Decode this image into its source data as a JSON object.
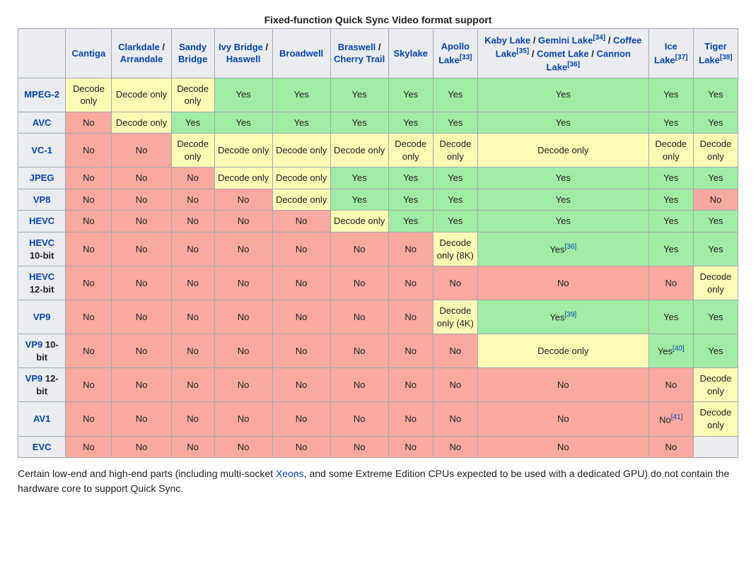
{
  "caption": "Fixed-function Quick Sync Video format support",
  "headers": [
    {
      "parts": [
        {
          "t": "Cantiga",
          "link": true
        }
      ]
    },
    {
      "parts": [
        {
          "t": "Clarkdale",
          "link": true
        },
        {
          "t": " / "
        },
        {
          "t": "Arrandale",
          "link": true
        }
      ]
    },
    {
      "parts": [
        {
          "t": "Sandy Bridge",
          "link": true
        }
      ]
    },
    {
      "parts": [
        {
          "t": "Ivy Bridge",
          "link": true
        },
        {
          "t": " / "
        },
        {
          "t": "Haswell",
          "link": true
        }
      ]
    },
    {
      "parts": [
        {
          "t": "Broadwell",
          "link": true
        }
      ]
    },
    {
      "parts": [
        {
          "t": "Braswell",
          "link": true
        },
        {
          "t": " / "
        },
        {
          "t": "Cherry Trail",
          "link": true
        }
      ]
    },
    {
      "parts": [
        {
          "t": "Skylake",
          "link": true
        }
      ]
    },
    {
      "parts": [
        {
          "t": "Apollo Lake",
          "link": true
        },
        {
          "sup": "[33]"
        }
      ]
    },
    {
      "parts": [
        {
          "t": "Kaby Lake",
          "link": true
        },
        {
          "t": " / "
        },
        {
          "t": "Gemini Lake",
          "link": true
        },
        {
          "sup": "[34]"
        },
        {
          "t": " / "
        },
        {
          "t": "Coffee Lake",
          "link": true
        },
        {
          "sup": "[35]"
        },
        {
          "t": " / "
        },
        {
          "t": "Comet Lake",
          "link": true
        },
        {
          "t": " / "
        },
        {
          "t": "Cannon Lake",
          "link": true
        },
        {
          "sup": "[36]"
        }
      ]
    },
    {
      "parts": [
        {
          "t": "Ice Lake",
          "link": true
        },
        {
          "sup": "[37]"
        }
      ]
    },
    {
      "parts": [
        {
          "t": "Tiger Lake",
          "link": true
        },
        {
          "sup": "[38]"
        }
      ]
    }
  ],
  "rows": [
    {
      "label": [
        {
          "t": "MPEG-2",
          "link": true
        }
      ],
      "cells": [
        {
          "v": "Decode only",
          "c": "decode"
        },
        {
          "v": "Decode only",
          "c": "decode"
        },
        {
          "v": "Decode only",
          "c": "decode"
        },
        {
          "v": "Yes",
          "c": "yes"
        },
        {
          "v": "Yes",
          "c": "yes"
        },
        {
          "v": "Yes",
          "c": "yes"
        },
        {
          "v": "Yes",
          "c": "yes"
        },
        {
          "v": "Yes",
          "c": "yes"
        },
        {
          "v": "Yes",
          "c": "yes"
        },
        {
          "v": "Yes",
          "c": "yes"
        },
        {
          "v": "Yes",
          "c": "yes"
        }
      ]
    },
    {
      "label": [
        {
          "t": "AVC",
          "link": true
        }
      ],
      "cells": [
        {
          "v": "No",
          "c": "no"
        },
        {
          "v": "Decode only",
          "c": "decode"
        },
        {
          "v": "Yes",
          "c": "yes"
        },
        {
          "v": "Yes",
          "c": "yes"
        },
        {
          "v": "Yes",
          "c": "yes"
        },
        {
          "v": "Yes",
          "c": "yes"
        },
        {
          "v": "Yes",
          "c": "yes"
        },
        {
          "v": "Yes",
          "c": "yes"
        },
        {
          "v": "Yes",
          "c": "yes"
        },
        {
          "v": "Yes",
          "c": "yes"
        },
        {
          "v": "Yes",
          "c": "yes"
        }
      ]
    },
    {
      "label": [
        {
          "t": "VC-1",
          "link": true
        }
      ],
      "cells": [
        {
          "v": "No",
          "c": "no"
        },
        {
          "v": "No",
          "c": "no"
        },
        {
          "v": "Decode only",
          "c": "decode"
        },
        {
          "v": "Decode only",
          "c": "decode"
        },
        {
          "v": "Decode only",
          "c": "decode"
        },
        {
          "v": "Decode only",
          "c": "decode"
        },
        {
          "v": "Decode only",
          "c": "decode"
        },
        {
          "v": "Decode only",
          "c": "decode"
        },
        {
          "v": "Decode only",
          "c": "decode"
        },
        {
          "v": "Decode only",
          "c": "decode"
        },
        {
          "v": "Decode only",
          "c": "decode"
        }
      ]
    },
    {
      "label": [
        {
          "t": "JPEG",
          "link": true
        }
      ],
      "cells": [
        {
          "v": "No",
          "c": "no"
        },
        {
          "v": "No",
          "c": "no"
        },
        {
          "v": "No",
          "c": "no"
        },
        {
          "v": "Decode only",
          "c": "decode"
        },
        {
          "v": "Decode only",
          "c": "decode"
        },
        {
          "v": "Yes",
          "c": "yes"
        },
        {
          "v": "Yes",
          "c": "yes"
        },
        {
          "v": "Yes",
          "c": "yes"
        },
        {
          "v": "Yes",
          "c": "yes"
        },
        {
          "v": "Yes",
          "c": "yes"
        },
        {
          "v": "Yes",
          "c": "yes"
        }
      ]
    },
    {
      "label": [
        {
          "t": "VP8",
          "link": true
        }
      ],
      "cells": [
        {
          "v": "No",
          "c": "no"
        },
        {
          "v": "No",
          "c": "no"
        },
        {
          "v": "No",
          "c": "no"
        },
        {
          "v": "No",
          "c": "no"
        },
        {
          "v": "Decode only",
          "c": "decode"
        },
        {
          "v": "Yes",
          "c": "yes"
        },
        {
          "v": "Yes",
          "c": "yes"
        },
        {
          "v": "Yes",
          "c": "yes"
        },
        {
          "v": "Yes",
          "c": "yes"
        },
        {
          "v": "Yes",
          "c": "yes"
        },
        {
          "v": "No",
          "c": "no"
        }
      ]
    },
    {
      "label": [
        {
          "t": "HEVC",
          "link": true
        }
      ],
      "cells": [
        {
          "v": "No",
          "c": "no"
        },
        {
          "v": "No",
          "c": "no"
        },
        {
          "v": "No",
          "c": "no"
        },
        {
          "v": "No",
          "c": "no"
        },
        {
          "v": "No",
          "c": "no"
        },
        {
          "v": "Decode only",
          "c": "decode"
        },
        {
          "v": "Yes",
          "c": "yes"
        },
        {
          "v": "Yes",
          "c": "yes"
        },
        {
          "v": "Yes",
          "c": "yes"
        },
        {
          "v": "Yes",
          "c": "yes"
        },
        {
          "v": "Yes",
          "c": "yes"
        }
      ]
    },
    {
      "label": [
        {
          "t": "HEVC",
          "link": true
        },
        {
          "t": " 10-bit"
        }
      ],
      "cells": [
        {
          "v": "No",
          "c": "no"
        },
        {
          "v": "No",
          "c": "no"
        },
        {
          "v": "No",
          "c": "no"
        },
        {
          "v": "No",
          "c": "no"
        },
        {
          "v": "No",
          "c": "no"
        },
        {
          "v": "No",
          "c": "no"
        },
        {
          "v": "No",
          "c": "no"
        },
        {
          "v": "Decode only (8K)",
          "c": "decode"
        },
        {
          "v": "Yes",
          "c": "yes",
          "sup": "[36]"
        },
        {
          "v": "Yes",
          "c": "yes"
        },
        {
          "v": "Yes",
          "c": "yes"
        }
      ]
    },
    {
      "label": [
        {
          "t": "HEVC",
          "link": true
        },
        {
          "t": " 12-bit"
        }
      ],
      "cells": [
        {
          "v": "No",
          "c": "no"
        },
        {
          "v": "No",
          "c": "no"
        },
        {
          "v": "No",
          "c": "no"
        },
        {
          "v": "No",
          "c": "no"
        },
        {
          "v": "No",
          "c": "no"
        },
        {
          "v": "No",
          "c": "no"
        },
        {
          "v": "No",
          "c": "no"
        },
        {
          "v": "No",
          "c": "no"
        },
        {
          "v": "No",
          "c": "no"
        },
        {
          "v": "No",
          "c": "no"
        },
        {
          "v": "Decode only",
          "c": "decode"
        }
      ]
    },
    {
      "label": [
        {
          "t": "VP9",
          "link": true
        }
      ],
      "cells": [
        {
          "v": "No",
          "c": "no"
        },
        {
          "v": "No",
          "c": "no"
        },
        {
          "v": "No",
          "c": "no"
        },
        {
          "v": "No",
          "c": "no"
        },
        {
          "v": "No",
          "c": "no"
        },
        {
          "v": "No",
          "c": "no"
        },
        {
          "v": "No",
          "c": "no"
        },
        {
          "v": "Decode only (4K)",
          "c": "decode"
        },
        {
          "v": "Yes",
          "c": "yes",
          "sup": "[39]"
        },
        {
          "v": "Yes",
          "c": "yes"
        },
        {
          "v": "Yes",
          "c": "yes"
        }
      ]
    },
    {
      "label": [
        {
          "t": "VP9",
          "link": true
        },
        {
          "t": " 10-bit"
        }
      ],
      "cells": [
        {
          "v": "No",
          "c": "no"
        },
        {
          "v": "No",
          "c": "no"
        },
        {
          "v": "No",
          "c": "no"
        },
        {
          "v": "No",
          "c": "no"
        },
        {
          "v": "No",
          "c": "no"
        },
        {
          "v": "No",
          "c": "no"
        },
        {
          "v": "No",
          "c": "no"
        },
        {
          "v": "No",
          "c": "no"
        },
        {
          "v": "Decode only",
          "c": "decode"
        },
        {
          "v": "Yes",
          "c": "yes",
          "sup": "[40]"
        },
        {
          "v": "Yes",
          "c": "yes"
        }
      ]
    },
    {
      "label": [
        {
          "t": "VP9",
          "link": true
        },
        {
          "t": " 12-bit"
        }
      ],
      "cells": [
        {
          "v": "No",
          "c": "no"
        },
        {
          "v": "No",
          "c": "no"
        },
        {
          "v": "No",
          "c": "no"
        },
        {
          "v": "No",
          "c": "no"
        },
        {
          "v": "No",
          "c": "no"
        },
        {
          "v": "No",
          "c": "no"
        },
        {
          "v": "No",
          "c": "no"
        },
        {
          "v": "No",
          "c": "no"
        },
        {
          "v": "No",
          "c": "no"
        },
        {
          "v": "No",
          "c": "no"
        },
        {
          "v": "Decode only",
          "c": "decode"
        }
      ]
    },
    {
      "label": [
        {
          "t": "AV1",
          "link": true
        }
      ],
      "cells": [
        {
          "v": "No",
          "c": "no"
        },
        {
          "v": "No",
          "c": "no"
        },
        {
          "v": "No",
          "c": "no"
        },
        {
          "v": "No",
          "c": "no"
        },
        {
          "v": "No",
          "c": "no"
        },
        {
          "v": "No",
          "c": "no"
        },
        {
          "v": "No",
          "c": "no"
        },
        {
          "v": "No",
          "c": "no"
        },
        {
          "v": "No",
          "c": "no"
        },
        {
          "v": "No",
          "c": "no",
          "sup": "[41]"
        },
        {
          "v": "Decode only",
          "c": "decode"
        }
      ]
    },
    {
      "label": [
        {
          "t": "EVC",
          "link": true
        }
      ],
      "cells": [
        {
          "v": "No",
          "c": "no"
        },
        {
          "v": "No",
          "c": "no"
        },
        {
          "v": "No",
          "c": "no"
        },
        {
          "v": "No",
          "c": "no"
        },
        {
          "v": "No",
          "c": "no"
        },
        {
          "v": "No",
          "c": "no"
        },
        {
          "v": "No",
          "c": "no"
        },
        {
          "v": "No",
          "c": "no"
        },
        {
          "v": "No",
          "c": "no"
        },
        {
          "v": "No",
          "c": "no"
        },
        {
          "v": "",
          "c": "blank"
        }
      ]
    }
  ],
  "footnote_parts": [
    {
      "t": "Certain low-end and high-end parts (including multi-socket "
    },
    {
      "t": "Xeons",
      "link": true
    },
    {
      "t": ", and some Extreme Edition CPUs expected to be used with a dedicated GPU) do not contain the hardware core to support Quick Sync."
    }
  ]
}
